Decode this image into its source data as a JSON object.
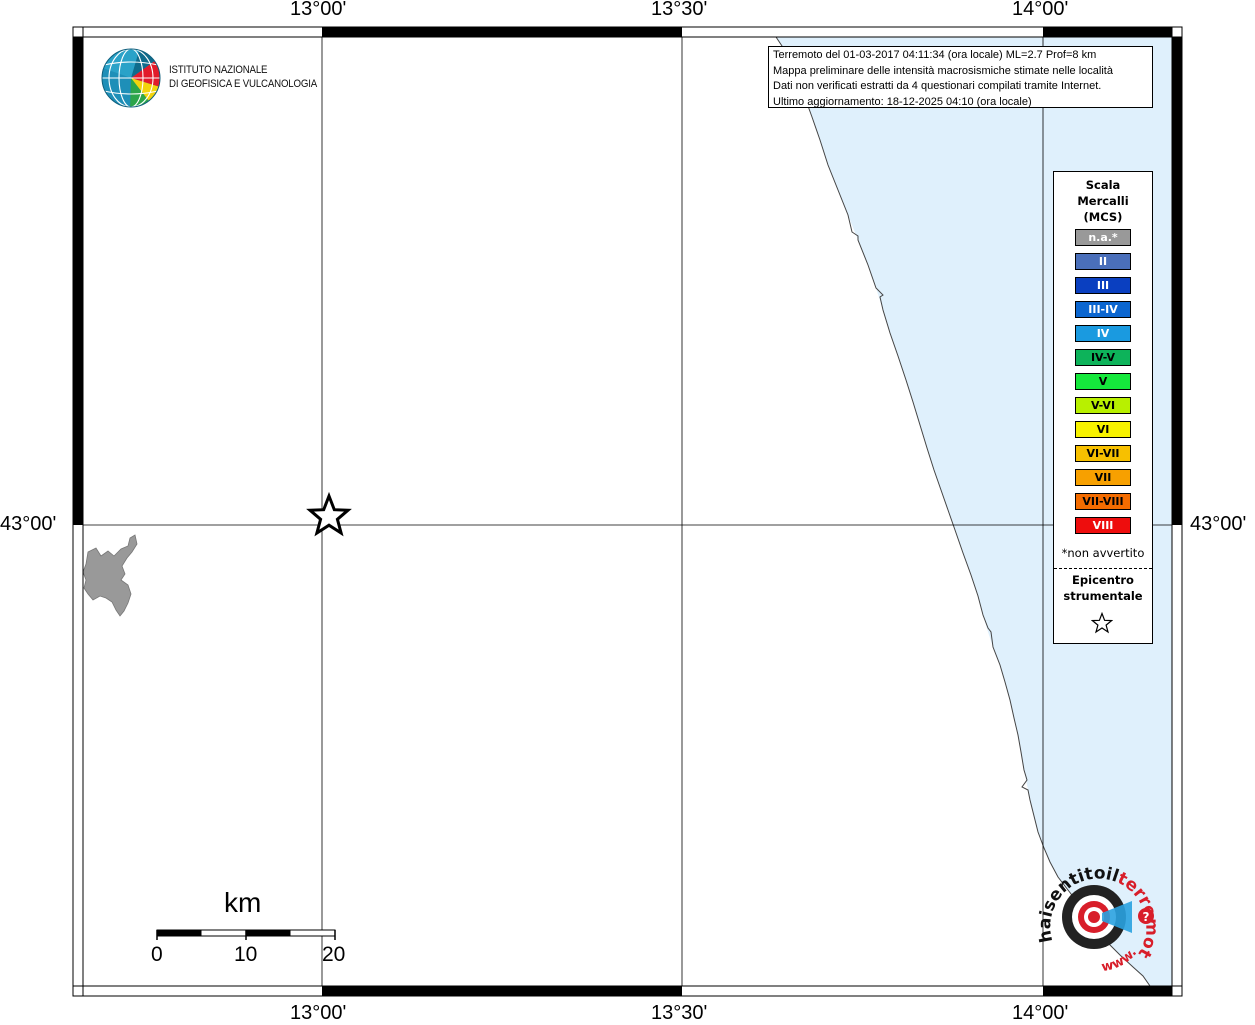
{
  "map": {
    "lon_labels_top": [
      "13°00'",
      "13°30'",
      "14°00'"
    ],
    "lon_labels_bottom": [
      "13°00'",
      "13°30'",
      "14°00'"
    ],
    "lat_label_left": "43°00'",
    "lat_label_right": "43°00'",
    "colors": {
      "sea": "#dff0fc",
      "land_area": "#999999",
      "grid": "#000000",
      "frame": "#000000"
    }
  },
  "info_box": {
    "lines": [
      "Terremoto del 01-03-2017 04:11:34 (ora locale) ML=2.7 Prof=8 km",
      "Mappa preliminare delle intensità macrosismiche stimate nelle località",
      "Dati non verificati estratti da 4 questionari compilati tramite Internet.",
      "Ultimo aggiornamento: 18-12-2025 04:10 (ora locale)"
    ]
  },
  "logo": {
    "lines": [
      "ISTITUTO NAZIONALE",
      "DI GEOFISICA E VULCANOLOGIA"
    ]
  },
  "legend": {
    "title_lines": [
      "Scala",
      "Mercalli",
      "(MCS)"
    ],
    "items": [
      {
        "label": "n.a.*",
        "color": "#999999",
        "text_color": "#ffffff"
      },
      {
        "label": "II",
        "color": "#4a6fba",
        "text_color": "#ffffff"
      },
      {
        "label": "III",
        "color": "#0a3fc0",
        "text_color": "#ffffff"
      },
      {
        "label": "III-IV",
        "color": "#0b66d0",
        "text_color": "#ffffff"
      },
      {
        "label": "IV",
        "color": "#1a9ae0",
        "text_color": "#ffffff"
      },
      {
        "label": "IV-V",
        "color": "#0db35a",
        "text_color": "#000000"
      },
      {
        "label": "V",
        "color": "#15e83c",
        "text_color": "#000000"
      },
      {
        "label": "V-VI",
        "color": "#b8f000",
        "text_color": "#000000"
      },
      {
        "label": "VI",
        "color": "#f7f200",
        "text_color": "#000000"
      },
      {
        "label": "VI-VII",
        "color": "#f7c000",
        "text_color": "#000000"
      },
      {
        "label": "VII",
        "color": "#f7a000",
        "text_color": "#000000"
      },
      {
        "label": "VII-VIII",
        "color": "#f46c00",
        "text_color": "#000000"
      },
      {
        "label": "VIII",
        "color": "#ee0d0d",
        "text_color": "#ffffff"
      }
    ],
    "note": "*non avvertito",
    "epicenter_lines": [
      "Epicentro",
      "strumentale"
    ]
  },
  "scale_bar": {
    "title": "km",
    "ticks": [
      "0",
      "10",
      "20"
    ]
  },
  "badge": {
    "text_dark": "haisentitoil",
    "text_red": "terremoto.it",
    "prefix": "www."
  }
}
